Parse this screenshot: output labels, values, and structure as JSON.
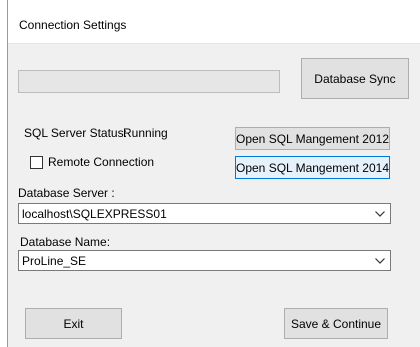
{
  "window": {
    "title": "Connection Settings"
  },
  "sync": {
    "progress": 0,
    "button_label": "Database Sync"
  },
  "status": {
    "label": "SQL Server Status:",
    "value": "Running"
  },
  "buttons": {
    "open2012": "Open SQL Mangement 2012",
    "open2014": "Open SQL Mangement 2014",
    "exit": "Exit",
    "save": "Save & Continue"
  },
  "remote": {
    "label": "Remote Connection",
    "checked": false
  },
  "server": {
    "label": "Database Server :",
    "value": "localhost\\SQLEXPRESS01"
  },
  "dbname": {
    "label": "Database Name:",
    "value": "ProLine_SE"
  },
  "colors": {
    "progress_fill": "#06b025",
    "focus_border": "#0078d7"
  }
}
